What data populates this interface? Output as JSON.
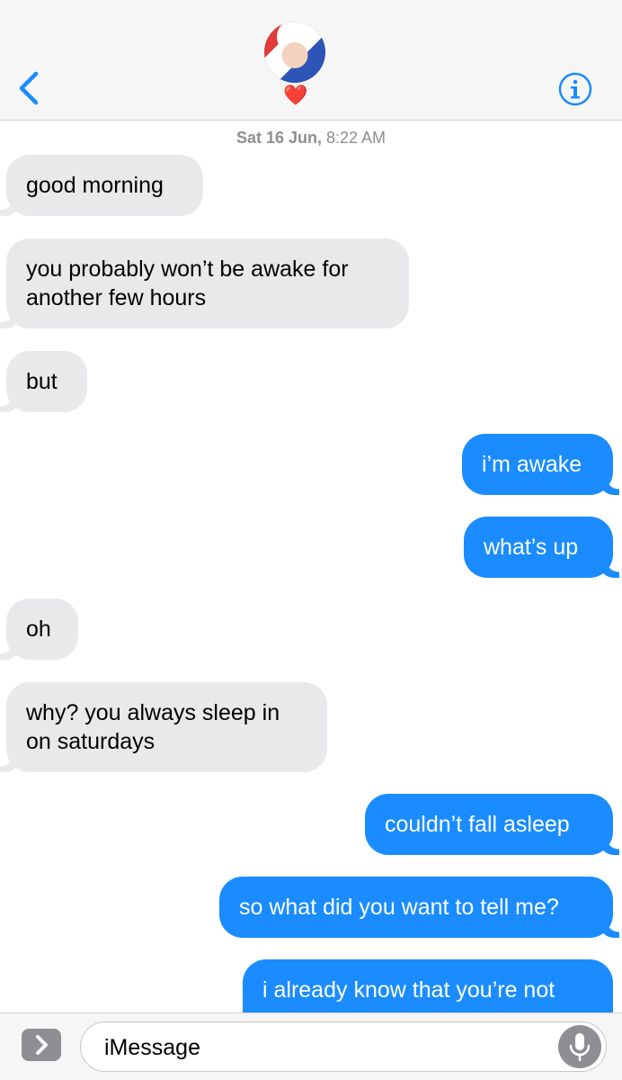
{
  "header": {
    "back_icon": "chevron-left-icon",
    "info_icon": "info-icon",
    "contact_reaction": "❤️",
    "accent_color": "#1a8cff"
  },
  "timestamp": {
    "day": "Sat 16 Jun,",
    "time": "8:22 AM"
  },
  "messages": [
    {
      "direction": "received",
      "text": "good morning"
    },
    {
      "direction": "received",
      "text": "you probably won’t be awake for another few hours"
    },
    {
      "direction": "received",
      "text": "but"
    },
    {
      "direction": "sent",
      "text": "i’m awake"
    },
    {
      "direction": "sent",
      "text": "what’s up"
    },
    {
      "direction": "received",
      "text": "oh"
    },
    {
      "direction": "received",
      "text": "why? you always sleep in on saturdays"
    },
    {
      "direction": "sent",
      "text": "couldn’t fall asleep"
    },
    {
      "direction": "sent",
      "text": "so what did you want to tell me?"
    },
    {
      "direction": "sent",
      "text": "i already know that you’re not"
    }
  ],
  "input_bar": {
    "placeholder": "iMessage",
    "apps_icon": "chevron-right-icon",
    "mic_icon": "microphone-icon"
  }
}
